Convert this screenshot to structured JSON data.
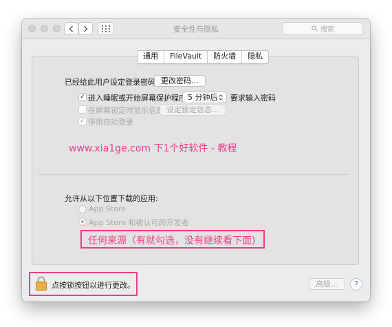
{
  "window": {
    "title": "安全性与隐私",
    "search_placeholder": "搜索"
  },
  "tabs": [
    {
      "label": "通用"
    },
    {
      "label": "FileVault"
    },
    {
      "label": "防火墙"
    },
    {
      "label": "隐私"
    }
  ],
  "general": {
    "password_label": "已经给此用户设定登录密码",
    "change_password_button": "更改密码...",
    "sleep_checkbox_label": "进入睡眠或开始屏幕保护程序",
    "sleep_checkbox_checked": true,
    "delay_value": "5 分钟后",
    "require_password_label": "要求输入密码",
    "lock_message_label": "在屏幕锁定时显示信息",
    "lock_message_checked": false,
    "set_lock_message_button": "设定锁定信息...",
    "disable_autologin_label": "停用自动登录",
    "disable_autologin_checked": true
  },
  "watermark": "www.xia1ge.com 下1个好软件 - 教程",
  "downloads": {
    "heading": "允许从以下位置下载的应用:",
    "options": [
      {
        "label": "App Store",
        "selected": false
      },
      {
        "label": "App Store 和被认可的开发者",
        "selected": true
      }
    ]
  },
  "annotation": "任何来源（有就勾选，没有继续看下面)",
  "footer": {
    "lock_text": "点按锁按钮以进行更改。",
    "advanced_button": "高级...",
    "help_button": "?"
  },
  "colors": {
    "accent_annotation": "#ee3e86",
    "annotation_border": "#e83f86",
    "lock_icon": "#e9a43a"
  }
}
